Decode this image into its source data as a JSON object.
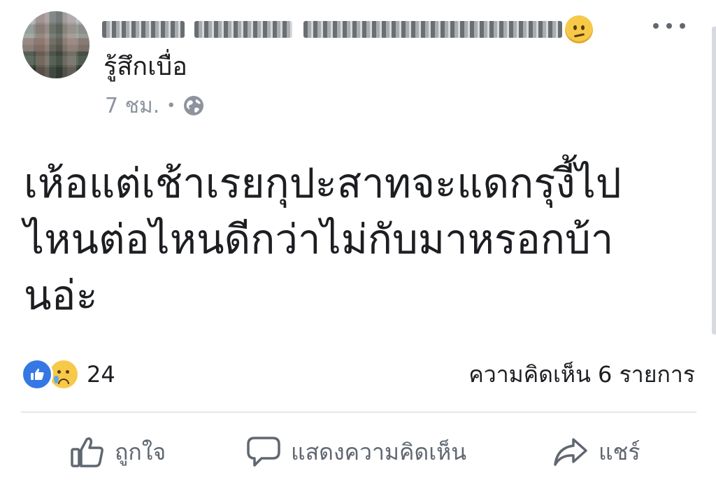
{
  "post": {
    "author_name": "",
    "feeling": "รู้สึกเบื่อ",
    "timestamp": "7 ชม.",
    "separator": "•",
    "privacy_icon": "globe-icon",
    "feeling_icon": "confused-face-emoji",
    "text_lines": [
      "เห้อแต่เช้าเรยกุปะสาทจะแดกรุงี้ไป",
      "ไหนต่อไหนดีกว่าไม่กับมาหรอกบ้า",
      "นอ่ะ"
    ]
  },
  "reactions": {
    "types": [
      "like",
      "sad"
    ],
    "count": "24"
  },
  "comments": {
    "label": "ความคิดเห็น 6 รายการ"
  },
  "actions": {
    "like_label": "ถูกใจ",
    "comment_label": "แสดงความคิดเห็น",
    "share_label": "แชร์"
  },
  "colors": {
    "like_blue": "#3578e5",
    "muted_text": "#8d949e",
    "action_text": "#606770",
    "divider": "#e4e6eb"
  }
}
